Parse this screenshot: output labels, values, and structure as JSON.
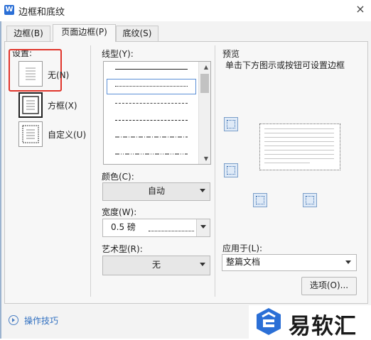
{
  "window": {
    "app_badge": "W",
    "title": "边框和底纹",
    "close": "×"
  },
  "tabs": [
    {
      "label": "边框(B)"
    },
    {
      "label": "页面边框(P)",
      "active": true
    },
    {
      "label": "底纹(S)"
    }
  ],
  "setting": {
    "heading": "设置:",
    "options": [
      {
        "label": "无(N)",
        "selected": true
      },
      {
        "label": "方框(X)"
      },
      {
        "label": "自定义(U)"
      }
    ]
  },
  "style": {
    "line_style_label": "线型(Y):",
    "color_label": "颜色(C):",
    "color_value": "自动",
    "width_label": "宽度(W):",
    "width_value": "0.5  磅",
    "art_label": "艺术型(R):",
    "art_value": "无"
  },
  "preview": {
    "heading": "预览",
    "hint": "单击下方图示或按钮可设置边框",
    "apply_to_label": "应用于(L):",
    "apply_to_value": "整篇文档",
    "options_button": "选项(O)..."
  },
  "footer": {
    "tips_link": "操作技巧"
  },
  "watermark": {
    "text": "易软汇"
  },
  "colors": {
    "accent": "#2b6fd6",
    "highlight_box": "#e0352b",
    "selection": "#5b8fd6"
  }
}
